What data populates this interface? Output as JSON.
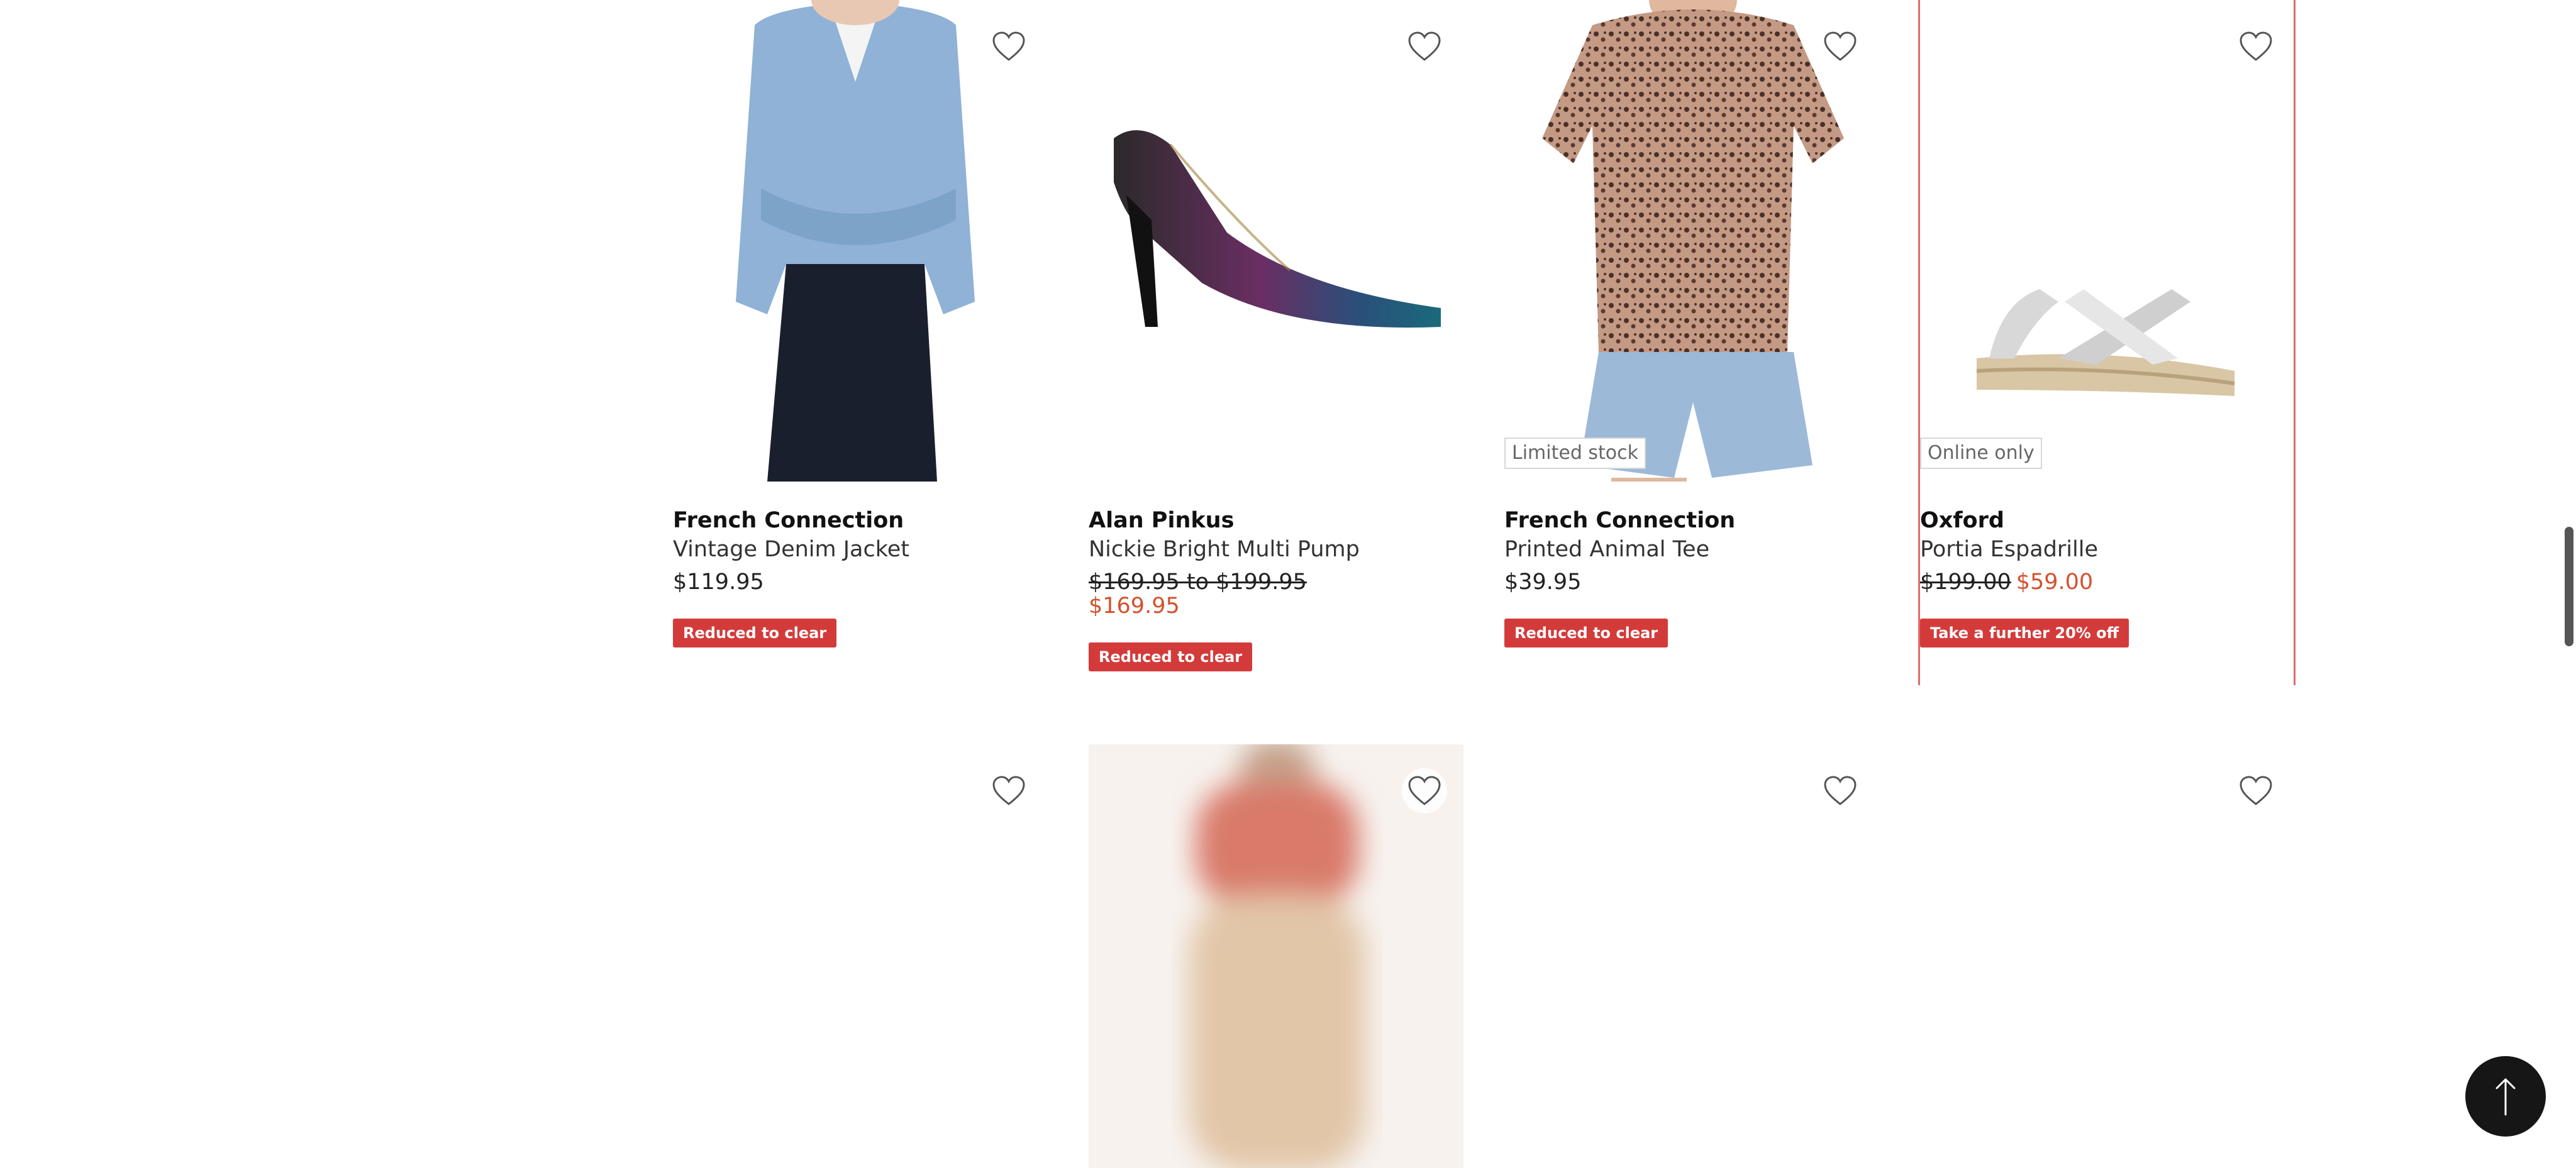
{
  "products_row1": [
    {
      "brand": "French Connection",
      "name": "Vintage Denim Jacket",
      "price": "$119.95",
      "promo": "Reduced to clear"
    },
    {
      "brand": "Alan Pinkus",
      "name": "Nickie Bright Multi Pump",
      "price_range": "$169.95 to $199.95",
      "sale_price": "$169.95",
      "promo": "Reduced to clear"
    },
    {
      "brand": "French Connection",
      "name": "Printed Animal Tee",
      "price": "$39.95",
      "tag": "Limited stock",
      "promo": "Reduced to clear"
    },
    {
      "brand": "Oxford",
      "name": "Portia Espadrille",
      "was_price": "$199.00",
      "now_price": "$59.00",
      "tag": "Online only",
      "promo": "Take a further 20% off"
    }
  ],
  "icons": {
    "wishlist": "heart-outline-icon",
    "back_to_top": "arrow-up-icon"
  },
  "colors": {
    "promo_bg": "#d33b3b",
    "sale_price": "#d4512c",
    "selected_border": "#e06a6a",
    "to_top_bg": "#161616"
  }
}
